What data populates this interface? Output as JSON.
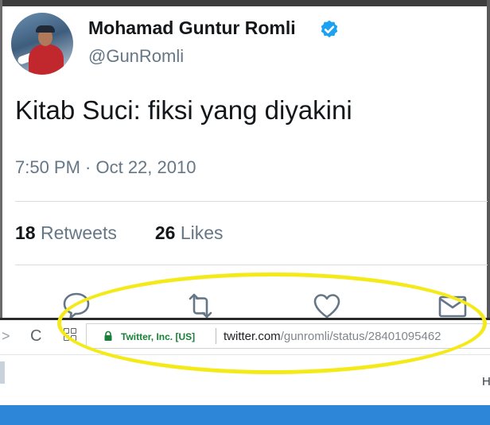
{
  "tweet": {
    "display_name": "Mohamad Guntur Romli",
    "handle": "@GunRomli",
    "text": "Kitab Suci: fiksi yang diyakini",
    "timestamp": "7:50 PM · Oct 22, 2010",
    "retweets_count": "18",
    "retweets_label": "Retweets",
    "likes_count": "26",
    "likes_label": "Likes"
  },
  "browser": {
    "reload_glyph": "C",
    "forward_glyph": ">",
    "certificate_org": "Twitter, Inc. [US]",
    "url_host": "twitter.com",
    "url_path": "/gunromli/status/28401095462",
    "edge_letter": "H"
  },
  "colors": {
    "verified": "#1da1f2",
    "secure_green": "#188038",
    "highlight": "#f4ea1a",
    "bottom_bar": "#2e86d9"
  },
  "icons": [
    "verified-badge-icon",
    "reply-icon",
    "retweet-icon",
    "like-icon",
    "direct-message-icon",
    "reload-icon",
    "apps-icon",
    "lock-icon"
  ]
}
